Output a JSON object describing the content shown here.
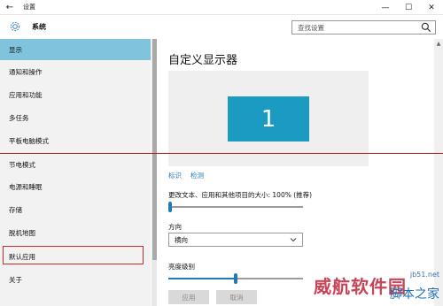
{
  "window": {
    "title": "设置",
    "back_icon": "arrow-left-icon",
    "controls": [
      "minimize",
      "maximize",
      "close"
    ]
  },
  "header": {
    "section_title": "系统",
    "search_placeholder": "查找设置"
  },
  "sidebar": {
    "items": [
      {
        "label": "显示",
        "active": true
      },
      {
        "label": "通知和操作"
      },
      {
        "label": "应用和功能"
      },
      {
        "label": "多任务"
      },
      {
        "label": "平板电脑模式"
      },
      {
        "label": "节电模式"
      },
      {
        "label": "电源和睡眠"
      },
      {
        "label": "存储"
      },
      {
        "label": "脱机地图"
      },
      {
        "label": "默认应用",
        "highlighted": true
      },
      {
        "label": "关于"
      }
    ]
  },
  "main": {
    "title": "自定义显示器",
    "monitor_number": "1",
    "links": [
      "标识",
      "检测"
    ],
    "scale_label": "更改文本、应用和其他项目的大小: 100% (推荐)",
    "scale_slider_value": 0,
    "orientation_label": "方向",
    "orientation_value": "横向",
    "brightness_label": "亮度级别",
    "brightness_slider_value": 0.5,
    "buttons": [
      "应用",
      "取消"
    ]
  },
  "watermark": {
    "line1": "威航软件园",
    "line2": "jb51.net",
    "line3": "脚本之家"
  },
  "colors": {
    "accent": "#1f7ab6",
    "sidebar_active": "#7fc4dc",
    "monitor": "#1c9bc2",
    "annotation_red": "#c21d1d"
  }
}
